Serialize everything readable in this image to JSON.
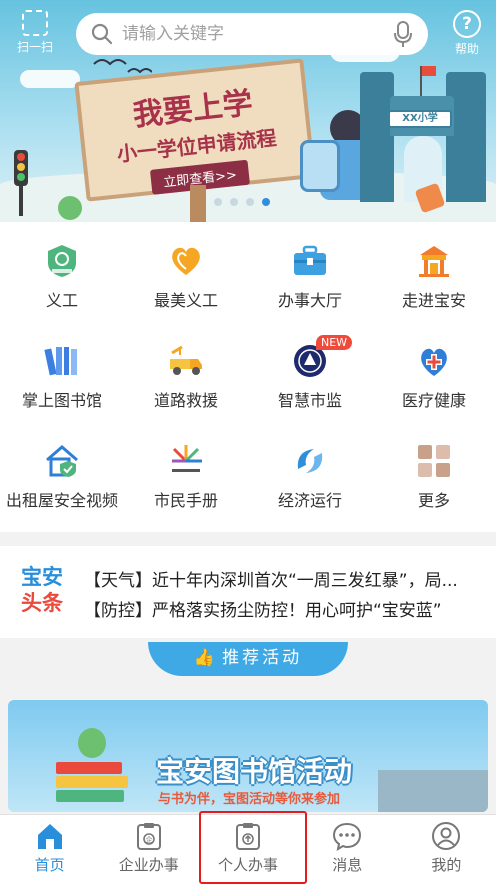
{
  "top_bar": {
    "scan_label": "扫一扫",
    "help_label": "帮助",
    "search_placeholder": "请输入关键字"
  },
  "banner": {
    "title": "我要上学",
    "subtitle": "小一学位申请流程",
    "cta": "立即查看>>",
    "school_sign": "XX小学",
    "slides": 4,
    "active_slide": 4
  },
  "services": [
    {
      "label": "义工",
      "icon": "volunteer-badge-icon"
    },
    {
      "label": "最美义工",
      "icon": "heart-icon"
    },
    {
      "label": "办事大厅",
      "icon": "briefcase-icon"
    },
    {
      "label": "走进宝安",
      "icon": "pavilion-icon"
    },
    {
      "label": "掌上图书馆",
      "icon": "books-icon"
    },
    {
      "label": "道路救援",
      "icon": "tow-truck-icon"
    },
    {
      "label": "智慧市监",
      "icon": "emblem-icon",
      "badge": "NEW"
    },
    {
      "label": "医疗健康",
      "icon": "medical-cross-icon"
    },
    {
      "label": "出租屋安全视频",
      "icon": "house-shield-icon"
    },
    {
      "label": "市民手册",
      "icon": "manual-logo-icon"
    },
    {
      "label": "经济运行",
      "icon": "economy-logo-icon"
    },
    {
      "label": "更多",
      "icon": "more-grid-icon"
    }
  ],
  "news": {
    "logo_top": "宝安",
    "logo_bottom": "头条",
    "items": [
      "【天气】近十年内深圳首次“一周三发红暴”，局...",
      "【防控】严格落实扬尘防控！用心呵护“宝安蓝”"
    ]
  },
  "recommend": {
    "title": "推荐活动",
    "activity_title": "宝安图书馆活动",
    "activity_subtitle": "与书为伴，宝图活动等你来参加"
  },
  "tabs": [
    {
      "label": "首页",
      "icon": "home-icon",
      "active": true
    },
    {
      "label": "企业办事",
      "icon": "enterprise-clipboard-icon",
      "active": false
    },
    {
      "label": "个人办事",
      "icon": "personal-clipboard-icon",
      "active": false,
      "highlighted": true
    },
    {
      "label": "消息",
      "icon": "message-icon",
      "active": false
    },
    {
      "label": "我的",
      "icon": "user-icon",
      "active": false
    }
  ],
  "colors": {
    "accent_blue": "#2a8fdb",
    "highlight_red": "#e31d1d",
    "news_red": "#e94a3d"
  }
}
